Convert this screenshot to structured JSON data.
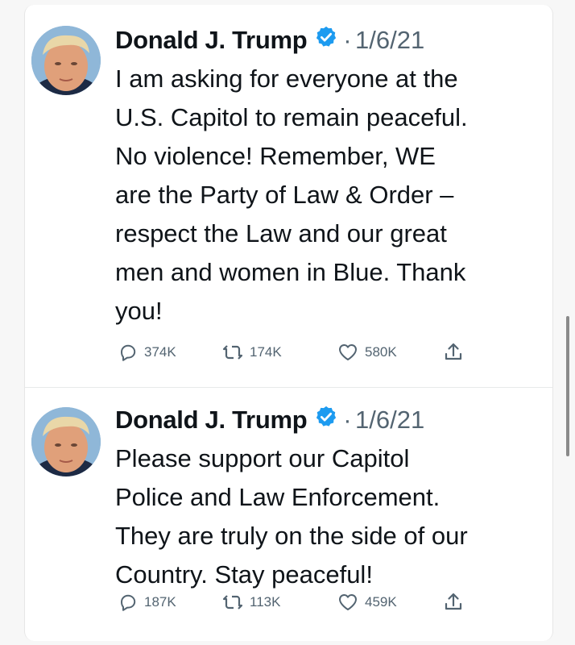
{
  "tweets": [
    {
      "author": "Donald J. Trump",
      "separator": "·",
      "date": "1/6/21",
      "more": "···",
      "text": "I am asking for everyone at the\nU.S. Capitol to remain peaceful.\nNo violence! Remember, WE\nare the Party of Law & Order –\nrespect the Law and our great\nmen and women in Blue. Thank\nyou!",
      "replies": "374K",
      "retweets": "174K",
      "likes": "580K"
    },
    {
      "author": "Donald J. Trump",
      "separator": "·",
      "date": "1/6/21",
      "more": "···",
      "text": "Please support our Capitol\nPolice and Law Enforcement.\nThey are truly on the side of our\nCountry. Stay peaceful!",
      "replies": "187K",
      "retweets": "113K",
      "likes": "459K"
    }
  ],
  "icons": {
    "avatar": "avatar-photo",
    "verified": "verified-badge-icon",
    "reply": "reply-icon",
    "retweet": "retweet-icon",
    "like": "heart-icon",
    "share": "share-icon"
  },
  "colors": {
    "verified": "#1d9bf0",
    "text": "#0f1419",
    "muted": "#536471"
  }
}
